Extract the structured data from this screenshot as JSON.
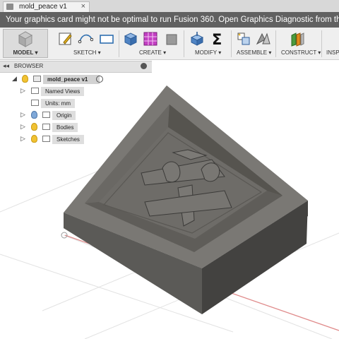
{
  "document_tab": {
    "title": "mold_peace v1",
    "close_glyph": "×"
  },
  "notification": {
    "text": "Your graphics card might not be optimal to run Fusion 360. Open Graphics Diagnostic from the help menu ('?' button"
  },
  "toolbar": {
    "workspace_label": "MODEL ▾",
    "groups": {
      "sketch": "SKETCH ▾",
      "create": "CREATE ▾",
      "modify": "MODIFY ▾",
      "assemble": "ASSEMBLE ▾",
      "construct": "CONSTRUCT ▾",
      "inspect": "INSPE"
    },
    "icons": [
      "create-sketch-icon",
      "arc-icon",
      "rectangle-icon",
      "box-icon",
      "pattern-icon",
      "press-pull-icon",
      "sum-icon",
      "joint-icon",
      "as-built-joint-icon",
      "offset-plane-icon"
    ]
  },
  "browser": {
    "title": "BROWSER",
    "root": "mold_peace v1",
    "named_views": "Named Views",
    "units": "Units: mm",
    "origin": "Origin",
    "bodies": "Bodies",
    "sketches": "Sketches"
  },
  "model": {
    "character": "平",
    "color": "#6e6c68"
  }
}
